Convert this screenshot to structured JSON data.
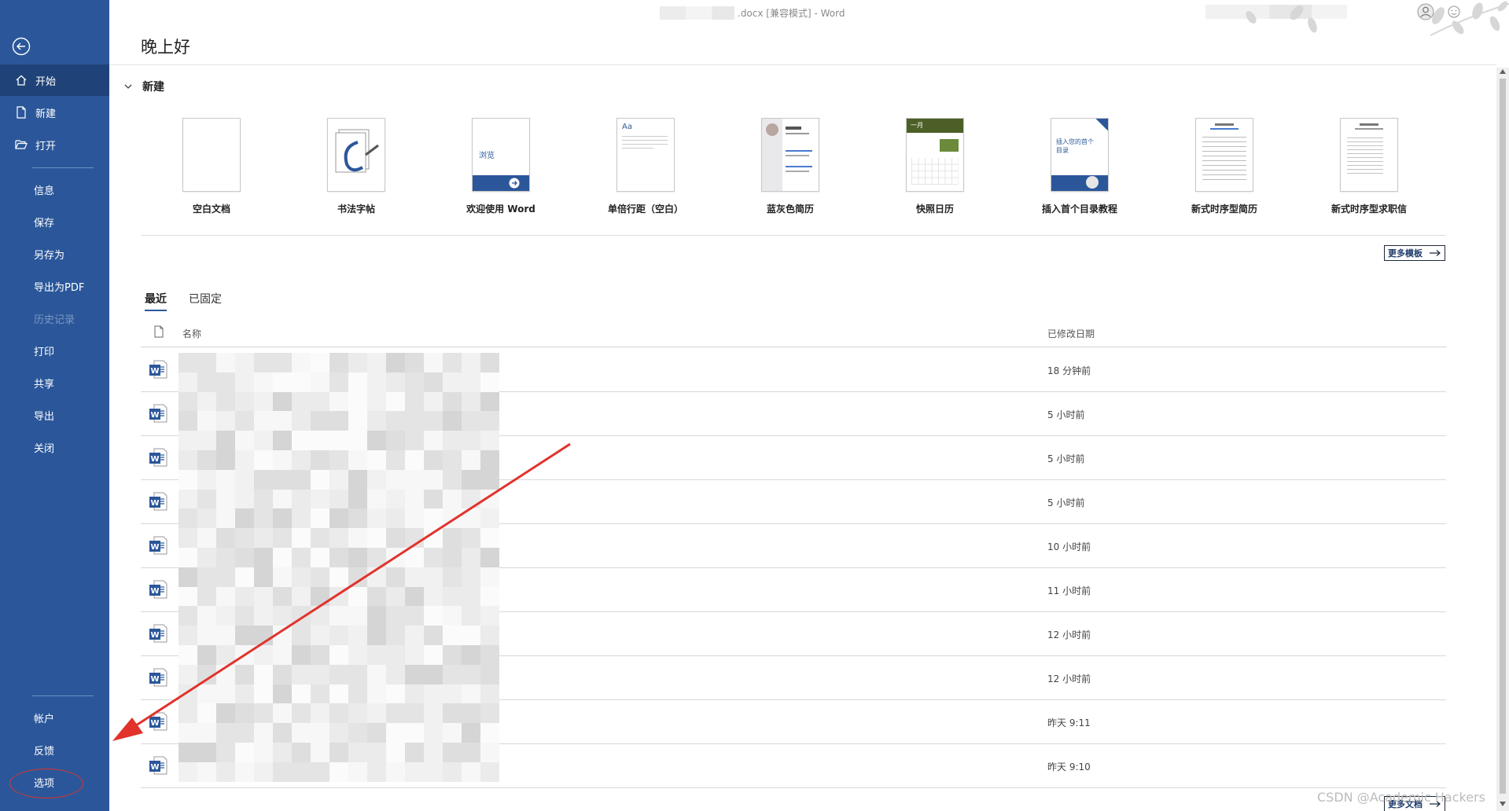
{
  "window": {
    "title": ".docx [兼容模式]  -  Word"
  },
  "sidebar": {
    "top_items": [
      {
        "label": "开始",
        "icon": "home-icon",
        "active": true
      },
      {
        "label": "新建",
        "icon": "new-document-icon"
      },
      {
        "label": "打开",
        "icon": "open-folder-icon"
      }
    ],
    "mid_items": [
      {
        "label": "信息"
      },
      {
        "label": "保存"
      },
      {
        "label": "另存为"
      },
      {
        "label": "导出为PDF"
      },
      {
        "label": "历史记录",
        "disabled": true
      },
      {
        "label": "打印"
      },
      {
        "label": "共享"
      },
      {
        "label": "导出"
      },
      {
        "label": "关闭"
      }
    ],
    "bottom_items": [
      {
        "label": "帐户"
      },
      {
        "label": "反馈"
      },
      {
        "label": "选项",
        "highlighted": true
      }
    ]
  },
  "main": {
    "greeting": "晚上好",
    "new_section": {
      "title": "新建",
      "templates": [
        {
          "name": "空白文档"
        },
        {
          "name": "书法字帖"
        },
        {
          "name": "欢迎使用 Word",
          "thumb_text": "浏览"
        },
        {
          "name": "单倍行距（空白）",
          "thumb_text": "Aa"
        },
        {
          "name": "蓝灰色简历"
        },
        {
          "name": "快照日历",
          "thumb_text": "一月"
        },
        {
          "name": "插入首个目录教程",
          "thumb_text": "插入您的首个目录"
        },
        {
          "name": "新式时序型简历"
        },
        {
          "name": "新式时序型求职信"
        }
      ],
      "more_label": "更多模板"
    },
    "tabs": [
      {
        "label": "最近"
      },
      {
        "label": "已固定"
      }
    ],
    "list": {
      "col_name": "名称",
      "col_date": "已修改日期",
      "rows": [
        {
          "date": "18 分钟前"
        },
        {
          "date": "5 小时前"
        },
        {
          "date": "5 小时前"
        },
        {
          "date": "5 小时前"
        },
        {
          "date": "10 小时前"
        },
        {
          "date": "11 小时前"
        },
        {
          "date": "12 小时前"
        },
        {
          "date": "12 小时前"
        },
        {
          "date": "昨天 9:11"
        },
        {
          "date": "昨天 9:10"
        }
      ],
      "more_label": "更多文档"
    }
  },
  "watermark": "CSDN @Academic Hackers",
  "colors": {
    "sidebar": "#2b579a",
    "annotation": "#e1322b",
    "word_blue": "#2b579a"
  }
}
